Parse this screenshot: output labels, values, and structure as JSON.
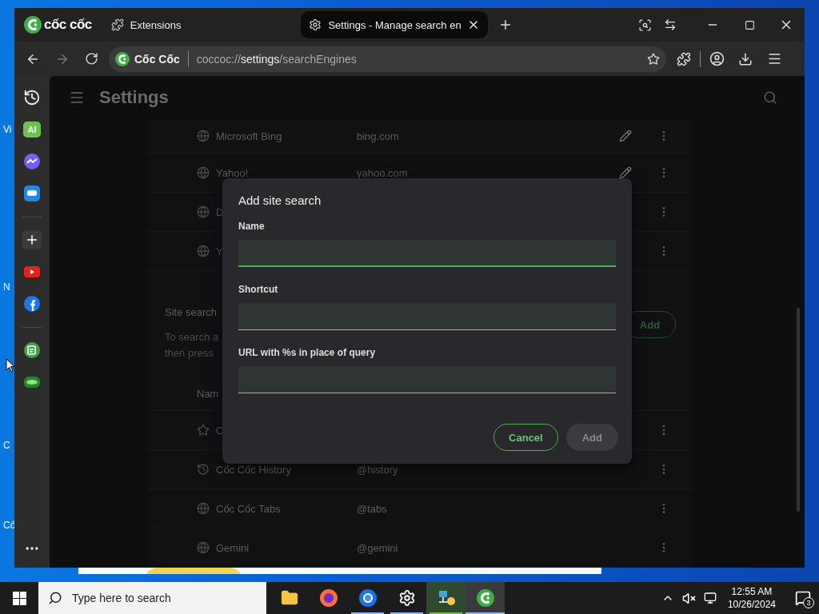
{
  "desktop_labels": [
    {
      "text": "Vi"
    },
    {
      "text": "N"
    },
    {
      "text": "C"
    },
    {
      "text": "Cố"
    }
  ],
  "browser": {
    "brand": "cốc cốc",
    "tabs": [
      {
        "label": "Extensions",
        "selected": false
      },
      {
        "label": "Settings - Manage search en",
        "selected": true
      }
    ],
    "address": {
      "site": "Cốc Cốc",
      "url": "coccoc://**settings**/searchEngines"
    },
    "sidebar_groups": [
      {
        "apps": [
          {
            "kind": "history"
          },
          {
            "kind": "ai",
            "label": "AI"
          },
          {
            "kind": "messenger"
          },
          {
            "kind": "zalo"
          }
        ]
      },
      {
        "apps": [
          {
            "kind": "add"
          },
          {
            "kind": "video"
          },
          {
            "kind": "social"
          }
        ]
      },
      {
        "apps": [
          {
            "kind": "notes"
          },
          {
            "kind": "shop"
          }
        ]
      }
    ]
  },
  "settings": {
    "title": "Settings",
    "engines": [
      {
        "name": "Microsoft Bing",
        "url": "bing.com",
        "editable": true
      },
      {
        "name": "Yahoo!",
        "url": "yahoo.com",
        "editable": true
      },
      {
        "name": "D",
        "editable": false
      },
      {
        "name": "Y",
        "editable": false
      }
    ],
    "site_search": {
      "title": "Site search",
      "add_label": "Add",
      "description": [
        "To search a",
        "then press"
      ],
      "column": "Nam",
      "rows": [
        {
          "name": "C"
        },
        {
          "name": "Cốc Cốc History",
          "shortcut": "@history"
        },
        {
          "name": "Cốc Cốc Tabs",
          "shortcut": "@tabs"
        },
        {
          "name": "Gemini",
          "shortcut": "@gemini"
        }
      ]
    }
  },
  "dialog": {
    "title": "Add site search",
    "fields": [
      {
        "label": "Name",
        "focused": true
      },
      {
        "label": "Shortcut",
        "focused": false
      },
      {
        "label": "URL with %s in place of query",
        "focused": false
      }
    ],
    "buttons": [
      {
        "label": "Cancel",
        "kind": "outline",
        "disabled": false
      },
      {
        "label": "Add",
        "kind": "primary",
        "disabled": true
      }
    ]
  },
  "taskbar": {
    "search_placeholder": "Type here to search",
    "apps": [
      {
        "kind": "folder",
        "running": false,
        "selected": false
      },
      {
        "kind": "firefox",
        "running": false,
        "selected": false
      },
      {
        "kind": "chrome",
        "running": true,
        "selected": false
      },
      {
        "kind": "settings",
        "running": true,
        "selected": false
      },
      {
        "kind": "network",
        "running": true,
        "selected": false
      },
      {
        "kind": "coccoc",
        "running": true,
        "selected": true
      }
    ],
    "time": "12:55 AM",
    "date": "10/26/2024",
    "notifications": "3"
  }
}
